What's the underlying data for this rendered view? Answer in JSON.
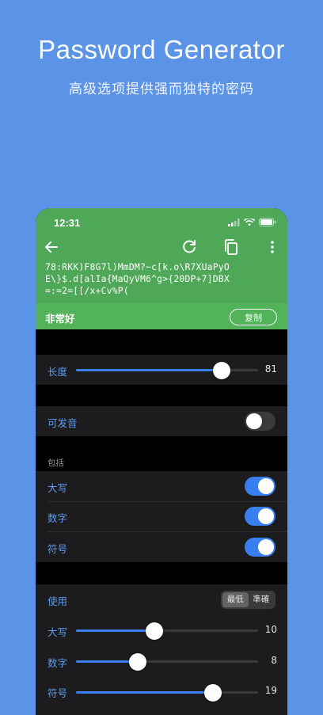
{
  "hero": {
    "title": "Password Generator",
    "subtitle": "高级选项提供强而独特的密码"
  },
  "status_bar": {
    "time": "12:31",
    "icons": [
      "signal-icon",
      "wifi-icon",
      "battery-icon"
    ]
  },
  "toolbar": {
    "icons": [
      "back-arrow-icon",
      "refresh-icon",
      "copy-icon",
      "more-vertical-icon"
    ]
  },
  "password": {
    "line1": "78:RKK)F8G7l)MmDM?~c[k.o\\R7XUaPyO",
    "line2": "E\\}$.d[alIa{MaQyVM6^g>{20DP+7]DBX",
    "line3": "=:=2=[[/x+Cv%P("
  },
  "strength": {
    "label": "非常好",
    "copy_button": "复制"
  },
  "length": {
    "label": "长度",
    "value": "81",
    "fraction": 0.8
  },
  "pronounceable": {
    "label": "可发音",
    "on": false
  },
  "include": {
    "header": "包括",
    "items": [
      {
        "label": "大写",
        "on": true
      },
      {
        "label": "数字",
        "on": true
      },
      {
        "label": "符号",
        "on": true
      }
    ]
  },
  "usage": {
    "label": "使用",
    "segments": [
      "最低",
      "準確"
    ],
    "selected": 0,
    "sliders": [
      {
        "label": "大写",
        "value": "10",
        "fraction": 0.43
      },
      {
        "label": "数字",
        "value": "8",
        "fraction": 0.34
      },
      {
        "label": "符号",
        "value": "19",
        "fraction": 0.75
      }
    ]
  },
  "colors": {
    "background": "#5b93e6",
    "header_green": "#4fa857",
    "strength_green": "#52b35a",
    "accent_blue": "#3a7ff0",
    "label_blue": "#5b9bf2"
  }
}
